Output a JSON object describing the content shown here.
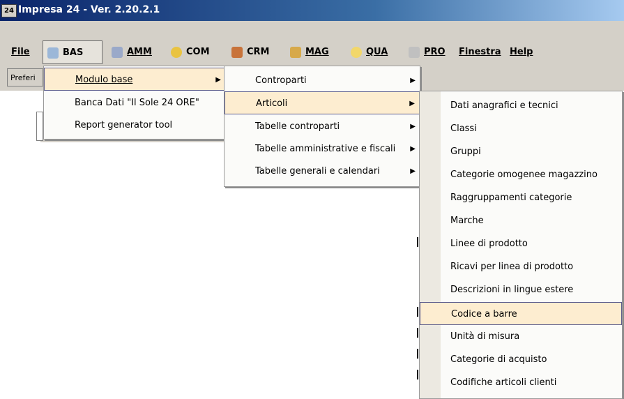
{
  "window": {
    "icon_text": "24",
    "title": "Impresa 24 - Ver. 2.20.2.1"
  },
  "menubar": {
    "items": [
      {
        "label": "File"
      },
      {
        "label": "BAS",
        "icon": "bas-icon",
        "icon_color": "#9bb7d8"
      },
      {
        "label": "AMM",
        "icon": "amm-icon",
        "icon_color": "#9aa9c9"
      },
      {
        "label": "COM",
        "icon": "com-icon",
        "icon_color": "#e9c341"
      },
      {
        "label": "CRM",
        "icon": "crm-icon",
        "icon_color": "#c8733a"
      },
      {
        "label": "MAG",
        "icon": "mag-icon",
        "icon_color": "#d7a94a"
      },
      {
        "label": "QUA",
        "icon": "qua-icon",
        "icon_color": "#f2d76b"
      },
      {
        "label": "PRO",
        "icon": "pro-icon",
        "icon_color": "#c0c0c0"
      },
      {
        "label": "Finestra"
      },
      {
        "label": "Help"
      }
    ]
  },
  "toolbar": {
    "pref_tab": "Preferi"
  },
  "menu1": {
    "items": [
      {
        "label": "Modulo base",
        "submenu": true,
        "highlighted": true
      },
      {
        "label": "Banca Dati \"Il Sole 24 ORE\""
      },
      {
        "label": "Report generator tool"
      }
    ]
  },
  "menu2": {
    "items": [
      {
        "label": "Controparti",
        "submenu": true
      },
      {
        "label": "Articoli",
        "submenu": true,
        "highlighted": true
      },
      {
        "label": "Tabelle controparti",
        "submenu": true
      },
      {
        "label": "Tabelle amministrative e fiscali",
        "submenu": true
      },
      {
        "label": "Tabelle generali e calendari",
        "submenu": true
      }
    ]
  },
  "menu3": {
    "items": [
      {
        "label": "Dati anagrafici e tecnici"
      },
      {
        "label": "Classi"
      },
      {
        "label": "Gruppi"
      },
      {
        "label": "Categorie omogenee magazzino"
      },
      {
        "label": "Raggruppamenti categorie"
      },
      {
        "label": "Marche"
      },
      {
        "label": "Linee di prodotto"
      },
      {
        "label": "Ricavi per linea di prodotto"
      },
      {
        "label": "Descrizioni in lingue estere"
      },
      {
        "label": "Codice a barre",
        "highlighted": true
      },
      {
        "label": "Unità di misura"
      },
      {
        "label": "Categorie di acquisto"
      },
      {
        "label": "Codifiche articoli clienti"
      }
    ]
  },
  "colors": {
    "highlight_bg": "#fdedd0",
    "highlight_border": "#5c5d8d",
    "title_bg": "#0a246a",
    "chrome": "#d4d0c8"
  }
}
